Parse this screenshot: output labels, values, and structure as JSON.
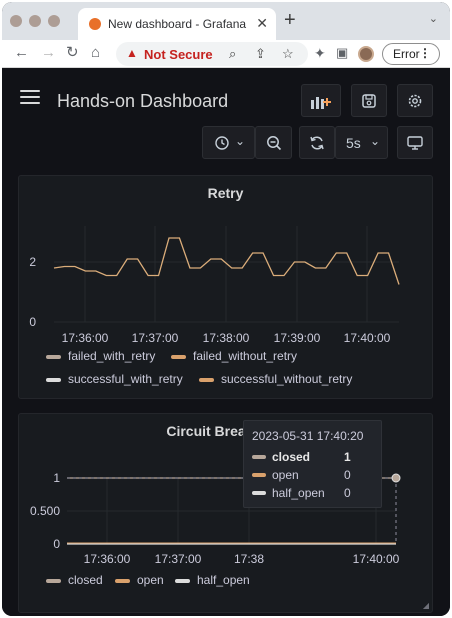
{
  "browser": {
    "tab_title": "New dashboard - Grafana",
    "new_tab": "+",
    "security": "Not Secure",
    "profile_status": "Error"
  },
  "dashboard": {
    "title": "Hands-on Dashboard",
    "refresh_interval": "5s"
  },
  "panels": [
    {
      "title": "Retry",
      "legend": [
        "failed_with_retry",
        "failed_without_retry",
        "successful_with_retry",
        "successful_without_retry"
      ]
    },
    {
      "title": "Circuit Breaker",
      "legend": [
        "closed",
        "open",
        "half_open"
      ],
      "tooltip": {
        "time": "2023-05-31 17:40:20",
        "rows": [
          {
            "name": "closed",
            "value": "1"
          },
          {
            "name": "open",
            "value": "0"
          },
          {
            "name": "half_open",
            "value": "0"
          }
        ]
      }
    }
  ],
  "colors": {
    "retry_line": "#dbad7a",
    "closed": "#b7a79a",
    "open": "#d9a16c",
    "half_open": "#dcdcdc",
    "successful_with_retry": "#dcdcdc",
    "successful_without_retry": "#d9a16c"
  },
  "chart_data": [
    {
      "type": "line",
      "title": "Retry",
      "x_ticks": [
        "17:36:00",
        "17:37:00",
        "17:38:00",
        "17:39:00",
        "17:40:00"
      ],
      "y_ticks": [
        "0",
        "2"
      ],
      "x_range_seconds": [
        17.3535,
        17.6818
      ],
      "ylim": [
        0,
        3.2
      ],
      "series": [
        {
          "name": "failed_with_retry",
          "x": [
            0,
            10,
            20,
            30,
            40,
            50,
            60,
            70,
            80,
            90,
            100,
            110,
            120,
            130,
            140,
            150,
            160,
            170,
            180,
            190,
            200,
            210,
            220,
            230,
            240,
            250,
            260,
            270,
            280,
            290,
            300,
            310,
            320,
            330
          ],
          "values": [
            1.8,
            1.85,
            1.85,
            1.7,
            1.7,
            1.55,
            1.55,
            2.1,
            2.1,
            1.55,
            1.55,
            2.8,
            2.8,
            1.8,
            1.8,
            2.1,
            2.1,
            1.8,
            1.8,
            2.3,
            2.3,
            1.55,
            1.55,
            2.0,
            2.0,
            1.8,
            1.8,
            2.3,
            2.3,
            1.55,
            1.55,
            2.3,
            2.3,
            1.25
          ]
        }
      ]
    },
    {
      "type": "line",
      "title": "Circuit Breaker",
      "x_ticks": [
        "17:36:00",
        "17:37:00",
        "17:38",
        "17:40:00"
      ],
      "y_ticks": [
        "0",
        "0.500",
        "1"
      ],
      "ylim": [
        0,
        1
      ],
      "series": [
        {
          "name": "closed",
          "values": [
            1,
            1
          ]
        },
        {
          "name": "open",
          "values": [
            0,
            0
          ]
        },
        {
          "name": "half_open",
          "values": [
            0,
            0
          ]
        }
      ]
    }
  ]
}
